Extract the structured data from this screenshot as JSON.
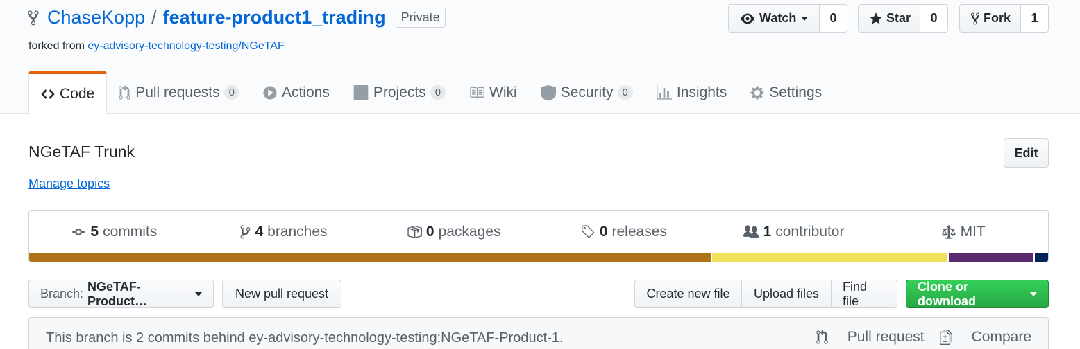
{
  "repo": {
    "owner": "ChaseKopp",
    "separator": "/",
    "name": "feature-product1_trading",
    "visibility": "Private",
    "forked_prefix": "forked from",
    "forked_from": "ey-advisory-technology-testing/NGeTAF"
  },
  "actions": {
    "watch_label": "Watch",
    "watch_count": "0",
    "star_label": "Star",
    "star_count": "0",
    "fork_label": "Fork",
    "fork_count": "1"
  },
  "tabs": [
    {
      "label": "Code",
      "icon": "code-icon"
    },
    {
      "label": "Pull requests",
      "counter": "0",
      "icon": "pull-request-icon"
    },
    {
      "label": "Actions",
      "icon": "play-icon"
    },
    {
      "label": "Projects",
      "counter": "0",
      "icon": "project-icon"
    },
    {
      "label": "Wiki",
      "icon": "book-icon"
    },
    {
      "label": "Security",
      "counter": "0",
      "icon": "shield-icon"
    },
    {
      "label": "Insights",
      "icon": "graph-icon"
    },
    {
      "label": "Settings",
      "icon": "gear-icon"
    }
  ],
  "about": {
    "description": "NGeTAF Trunk",
    "edit_label": "Edit",
    "topics_label": "Manage topics"
  },
  "summary": {
    "commits_count": "5",
    "commits_label": "commits",
    "branches_count": "4",
    "branches_label": "branches",
    "packages_count": "0",
    "packages_label": "packages",
    "releases_count": "0",
    "releases_label": "releases",
    "contributors_count": "1",
    "contributors_label": "contributor",
    "license": "MIT"
  },
  "languages": [
    {
      "color": "#b07219",
      "share": 0.669
    },
    {
      "color": "#f1e05a",
      "share": 0.232
    },
    {
      "color": "#5b2a6e",
      "share": 0.085
    },
    {
      "color": "#012456",
      "share": 0.014
    }
  ],
  "toolbar": {
    "branch_prefix": "Branch:",
    "branch_name": "NGeTAF-Product…",
    "new_pr": "New pull request",
    "create_file": "Create new file",
    "upload_files": "Upload files",
    "find_file": "Find file",
    "clone": "Clone or download"
  },
  "branch_status": {
    "message": "This branch is 2 commits behind ey-advisory-technology-testing:NGeTAF-Product-1.",
    "pull_request": "Pull request",
    "compare": "Compare"
  }
}
